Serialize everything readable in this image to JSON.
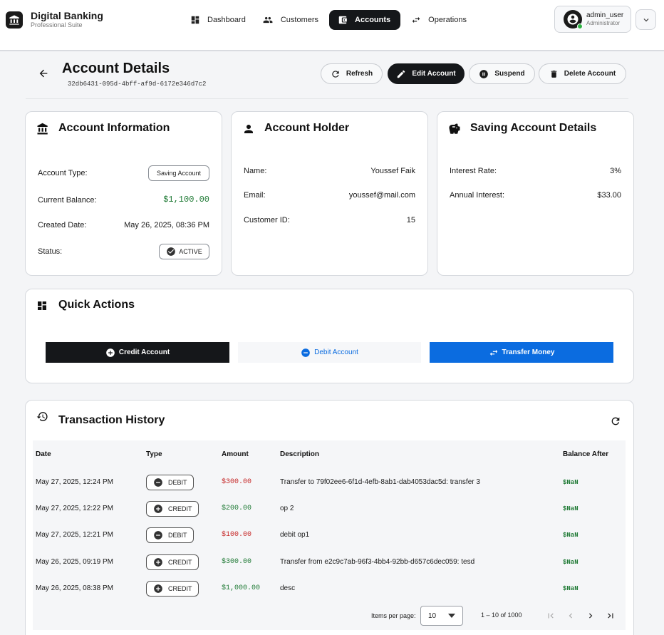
{
  "app": {
    "title": "Digital Banking",
    "subtitle": "Professional Suite"
  },
  "nav": {
    "items": [
      {
        "label": "Dashboard",
        "icon": "dashboard-icon"
      },
      {
        "label": "Customers",
        "icon": "people-icon"
      },
      {
        "label": "Accounts",
        "icon": "wallet-icon",
        "active": true
      },
      {
        "label": "Operations",
        "icon": "swap-icon"
      }
    ]
  },
  "user": {
    "name": "admin_user",
    "role": "Administrator",
    "status_color": "#2fb344"
  },
  "header": {
    "title": "Account Details",
    "account_id": "32db6431-095d-4bff-af9d-6172e346d7c2",
    "buttons": {
      "refresh": "Refresh",
      "edit": "Edit Account",
      "suspend": "Suspend",
      "delete": "Delete Account"
    }
  },
  "account_info": {
    "title": "Account Information",
    "type_label": "Account Type:",
    "type_value": "Saving Account",
    "balance_label": "Current Balance:",
    "balance_value": "$1,100.00",
    "created_label": "Created Date:",
    "created_value": "May 26, 2025, 08:36 PM",
    "status_label": "Status:",
    "status_value": "ACTIVE"
  },
  "holder": {
    "title": "Account Holder",
    "name_label": "Name:",
    "name_value": "Youssef Faik",
    "email_label": "Email:",
    "email_value": "youssef@mail.com",
    "id_label": "Customer ID:",
    "id_value": "15"
  },
  "saving": {
    "title": "Saving Account Details",
    "rate_label": "Interest Rate:",
    "rate_value": "3%",
    "annual_label": "Annual Interest:",
    "annual_value": "$33.00"
  },
  "quick_actions": {
    "title": "Quick Actions",
    "credit": "Credit Account",
    "debit": "Debit Account",
    "transfer": "Transfer Money"
  },
  "transactions": {
    "title": "Transaction History",
    "columns": [
      "Date",
      "Type",
      "Amount",
      "Description",
      "Balance After"
    ],
    "rows": [
      {
        "date": "May 27, 2025, 12:24 PM",
        "type": "DEBIT",
        "amount": "$300.00",
        "description": "Transfer to 79f02ee6-6f1d-4efb-8ab1-dab4053dac5d: transfer 3",
        "balance": "$NaN"
      },
      {
        "date": "May 27, 2025, 12:22 PM",
        "type": "CREDIT",
        "amount": "$200.00",
        "description": "op 2",
        "balance": "$NaN"
      },
      {
        "date": "May 27, 2025, 12:21 PM",
        "type": "DEBIT",
        "amount": "$100.00",
        "description": "debit op1",
        "balance": "$NaN"
      },
      {
        "date": "May 26, 2025, 09:19 PM",
        "type": "CREDIT",
        "amount": "$300.00",
        "description": "Transfer from e2c9c7ab-96f3-4bb4-92bb-d657c6dec059: tesd",
        "balance": "$NaN"
      },
      {
        "date": "May 26, 2025, 08:38 PM",
        "type": "CREDIT",
        "amount": "$1,000.00",
        "description": "desc",
        "balance": "$NaN"
      }
    ],
    "pager": {
      "items_label": "Items per page:",
      "page_size": "10",
      "range": "1 – 10 of 1000"
    }
  },
  "colors": {
    "primary_dark": "#15171a",
    "accent_blue": "#0b6ce0",
    "debit_red": "#c62828",
    "credit_green": "#1f7a35"
  }
}
